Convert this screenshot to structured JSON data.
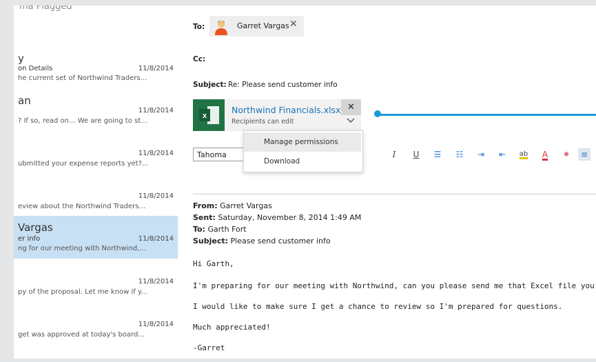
{
  "list": {
    "filter_text": "ma   Flagged",
    "items": [
      {
        "sender": "y",
        "subject": "on Details",
        "date": "11/8/2014",
        "preview": "he current set of Northwind Traders..."
      },
      {
        "sender": "an",
        "subject": "",
        "date": "11/8/2014",
        "preview": "? If so, read on... We are going to st..."
      },
      {
        "sender": "",
        "subject": "",
        "date": "11/8/2014",
        "preview": "ubmitted your expense reports yet?..."
      },
      {
        "sender": "",
        "subject": "",
        "date": "11/8/2014",
        "preview": "eview about the Northwind Traders..."
      },
      {
        "sender": "Vargas",
        "subject": "er info",
        "date": "11/8/2014",
        "preview": "ng for our meeting with Northwind,..."
      },
      {
        "sender": "",
        "subject": "",
        "date": "11/8/2014",
        "preview": "py of the proposal. Let me know if y..."
      },
      {
        "sender": "",
        "subject": "",
        "date": "11/8/2014",
        "preview": "get was approved at today's board..."
      }
    ]
  },
  "compose": {
    "to_label": "To:",
    "to_name": "Garret Vargas",
    "cc_label": "Cc:",
    "subject_label": "Subject:",
    "subject_value": "Re: Please send customer info",
    "attachment": {
      "name": "Northwind Financials.xlsx",
      "sub": "Recipients can edit",
      "icon_letter": "x"
    },
    "font_name": "Tahoma",
    "menu": [
      "Manage permissions",
      "Download"
    ],
    "toolbar": [
      {
        "icon": "italic-icon",
        "glyph": "I"
      },
      {
        "icon": "underline-icon",
        "glyph": "U"
      },
      {
        "icon": "bullets-icon",
        "glyph": "☰"
      },
      {
        "icon": "numbering-icon",
        "glyph": "☷"
      },
      {
        "icon": "indent-icon",
        "glyph": "⇥"
      },
      {
        "icon": "outdent-icon",
        "glyph": "⇤"
      },
      {
        "icon": "highlight-icon",
        "glyph": "ab"
      },
      {
        "icon": "font-color-icon",
        "glyph": "A"
      },
      {
        "icon": "clear-format-icon",
        "glyph": "◆"
      },
      {
        "icon": "align-left-icon",
        "glyph": "≡"
      },
      {
        "icon": "align-center-icon",
        "glyph": "≡"
      }
    ],
    "quoted": {
      "from_label": "From:",
      "from_value": "Garret Vargas",
      "sent_label": "Sent:",
      "sent_value": "Saturday, November 8, 2014 1:49 AM",
      "to_label": "To:",
      "to_value": "Garth Fort",
      "subject_label": "Subject:",
      "subject_value": "Please send customer info"
    },
    "body": {
      "greeting": "Hi Garth,",
      "p1": "I'm preparing for our meeting with Northwind, can you please send me that Excel file you showed me with",
      "p2": "I would like to make sure I get a chance to review so I'm prepared for questions.",
      "p3": "Much appreciated!",
      "sign": "-Garret"
    }
  },
  "colors": {
    "accent": "#1b9cd8",
    "selected": "#c7e0f4",
    "excel": "#217346",
    "link": "#1a74b8"
  }
}
